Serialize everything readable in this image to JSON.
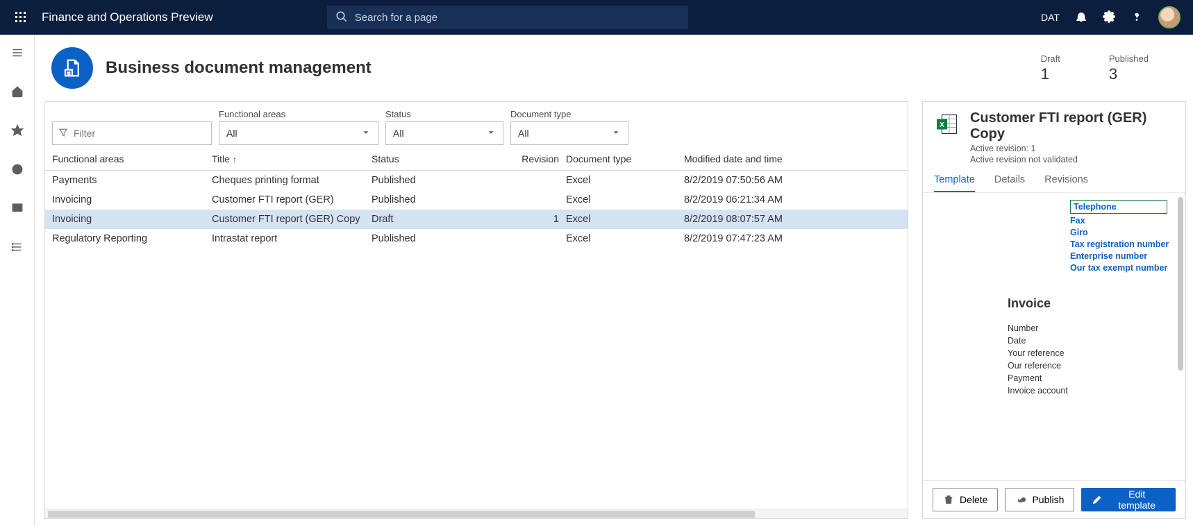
{
  "top": {
    "brand": "Finance and Operations Preview",
    "search_placeholder": "Search for a page",
    "company": "DAT"
  },
  "page": {
    "title": "Business document management",
    "kpis": [
      {
        "label": "Draft",
        "value": "1"
      },
      {
        "label": "Published",
        "value": "3"
      }
    ]
  },
  "filters": {
    "filter_placeholder": "Filter",
    "functional_areas": {
      "label": "Functional areas",
      "value": "All"
    },
    "status": {
      "label": "Status",
      "value": "All"
    },
    "document_type": {
      "label": "Document type",
      "value": "All"
    }
  },
  "columns": {
    "fa": "Functional areas",
    "title": "Title",
    "status": "Status",
    "revision": "Revision",
    "doc": "Document type",
    "date": "Modified date and time"
  },
  "rows": [
    {
      "fa": "Payments",
      "title": "Cheques printing format",
      "status": "Published",
      "rev": "",
      "doc": "Excel",
      "date": "8/2/2019 07:50:56 AM",
      "sel": false
    },
    {
      "fa": "Invoicing",
      "title": "Customer FTI report (GER)",
      "status": "Published",
      "rev": "",
      "doc": "Excel",
      "date": "8/2/2019 06:21:34 AM",
      "sel": false
    },
    {
      "fa": "Invoicing",
      "title": "Customer FTI report (GER) Copy",
      "status": "Draft",
      "rev": "1",
      "doc": "Excel",
      "date": "8/2/2019 08:07:57 AM",
      "sel": true
    },
    {
      "fa": "Regulatory Reporting",
      "title": "Intrastat report",
      "status": "Published",
      "rev": "",
      "doc": "Excel",
      "date": "8/2/2019 07:47:23 AM",
      "sel": false
    }
  ],
  "side": {
    "title": "Customer FTI report (GER) Copy",
    "sub1": "Active revision: 1",
    "sub2": "Active revision not validated",
    "tabs": {
      "template": "Template",
      "details": "Details",
      "revisions": "Revisions"
    },
    "preview": {
      "links": [
        "Telephone",
        "Fax",
        "Giro",
        "Tax registration number",
        "Enterprise number",
        "Our tax exempt number"
      ],
      "heading": "Invoice",
      "fields": [
        "Number",
        "Date",
        "Your reference",
        "Our reference",
        "Payment",
        "Invoice account"
      ]
    },
    "buttons": {
      "delete": "Delete",
      "publish": "Publish",
      "edit": "Edit template"
    }
  }
}
